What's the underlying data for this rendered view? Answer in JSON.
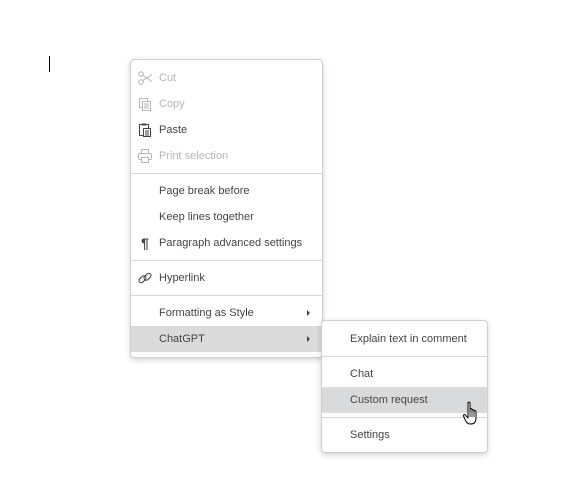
{
  "context_menu": {
    "items": [
      {
        "label": "Cut",
        "icon": "scissors-icon",
        "disabled": true
      },
      {
        "label": "Copy",
        "icon": "copy-icon",
        "disabled": true
      },
      {
        "label": "Paste",
        "icon": "paste-icon",
        "disabled": false
      },
      {
        "label": "Print selection",
        "icon": "printer-icon",
        "disabled": true
      },
      {
        "label": "Page break before"
      },
      {
        "label": "Keep lines together"
      },
      {
        "label": "Paragraph advanced settings",
        "icon": "pilcrow-icon"
      },
      {
        "label": "Hyperlink",
        "icon": "link-icon"
      },
      {
        "label": "Formatting as Style",
        "submenu": true
      },
      {
        "label": "ChatGPT",
        "submenu": true,
        "active": true
      }
    ]
  },
  "chatgpt_submenu": {
    "items": [
      {
        "label": "Explain text in comment"
      },
      {
        "label": "Chat"
      },
      {
        "label": "Custom request",
        "hovered": true
      },
      {
        "label": "Settings"
      }
    ]
  },
  "colors": {
    "active_item_bg": "#d8dadc",
    "disabled_text": "#b6b6b6",
    "text": "#444444"
  }
}
